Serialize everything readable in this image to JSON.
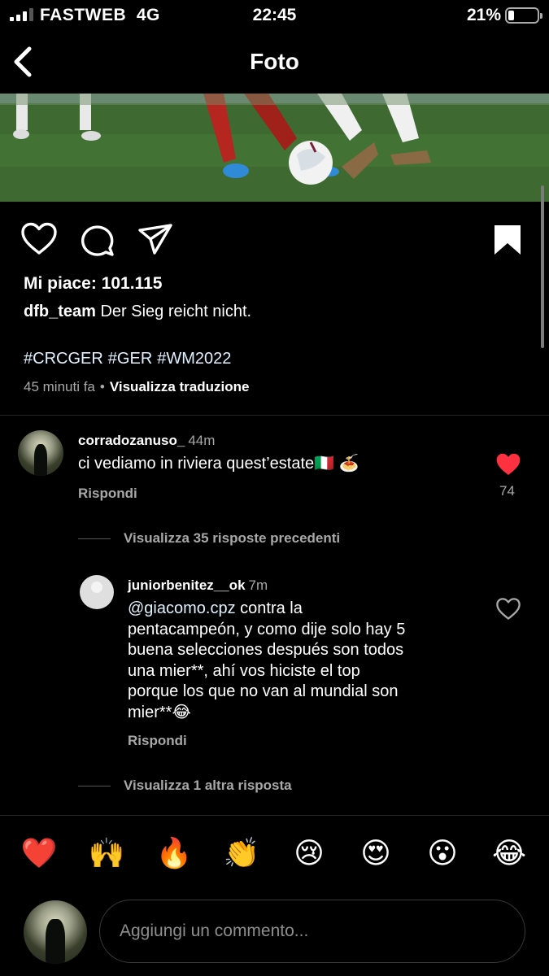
{
  "status_bar": {
    "carrier": "FASTWEB",
    "network": "4G",
    "time": "22:45",
    "battery_percent": "21%",
    "battery_level": 0.21
  },
  "header": {
    "title": "Foto",
    "back_icon": "chevron-left-icon"
  },
  "post": {
    "actions": [
      "heart-icon",
      "comment-icon",
      "share-icon",
      "bookmark-icon"
    ],
    "likes_label": "Mi piace: 101.115",
    "author": "dfb_team",
    "caption": "Der Sieg reicht nicht.",
    "hashtags": [
      "#CRCGER",
      "#GER",
      "#WM2022"
    ],
    "posted_ago": "45 minuti fa",
    "translate_label": "Visualizza traduzione"
  },
  "comments": [
    {
      "username": "corradozanuso_",
      "time": "44m",
      "text": "ci vediamo in riviera quest’estate🇮🇹 🍝",
      "reply_label": "Rispondi",
      "liked": true,
      "like_count": "74",
      "view_replies": "Visualizza 35 risposte precedenti"
    },
    {
      "username": "juniorbenitez__ok",
      "time": "7m",
      "mention": "@giacomo.cpz",
      "text_lines": [
        "contra la",
        "pentacampeón, y como dije solo hay 5",
        "buena selecciones después son todos",
        "una mier**, ahí vos hiciste el top",
        "porque los que no van al mundial son",
        "mier**😂"
      ],
      "reply_label": "Rispondi",
      "liked": false,
      "view_more": "Visualizza 1 altra risposta"
    }
  ],
  "emoji_bar": [
    "❤️",
    "🙌",
    "🔥",
    "👏",
    "😢",
    "😍",
    "😮",
    "😂"
  ],
  "composer": {
    "placeholder": "Aggiungi un commento..."
  },
  "colors": {
    "background": "#000000",
    "like_red": "#ff3040",
    "secondary_text": "#a8a8a8",
    "hashtag": "#e0f1ff"
  }
}
